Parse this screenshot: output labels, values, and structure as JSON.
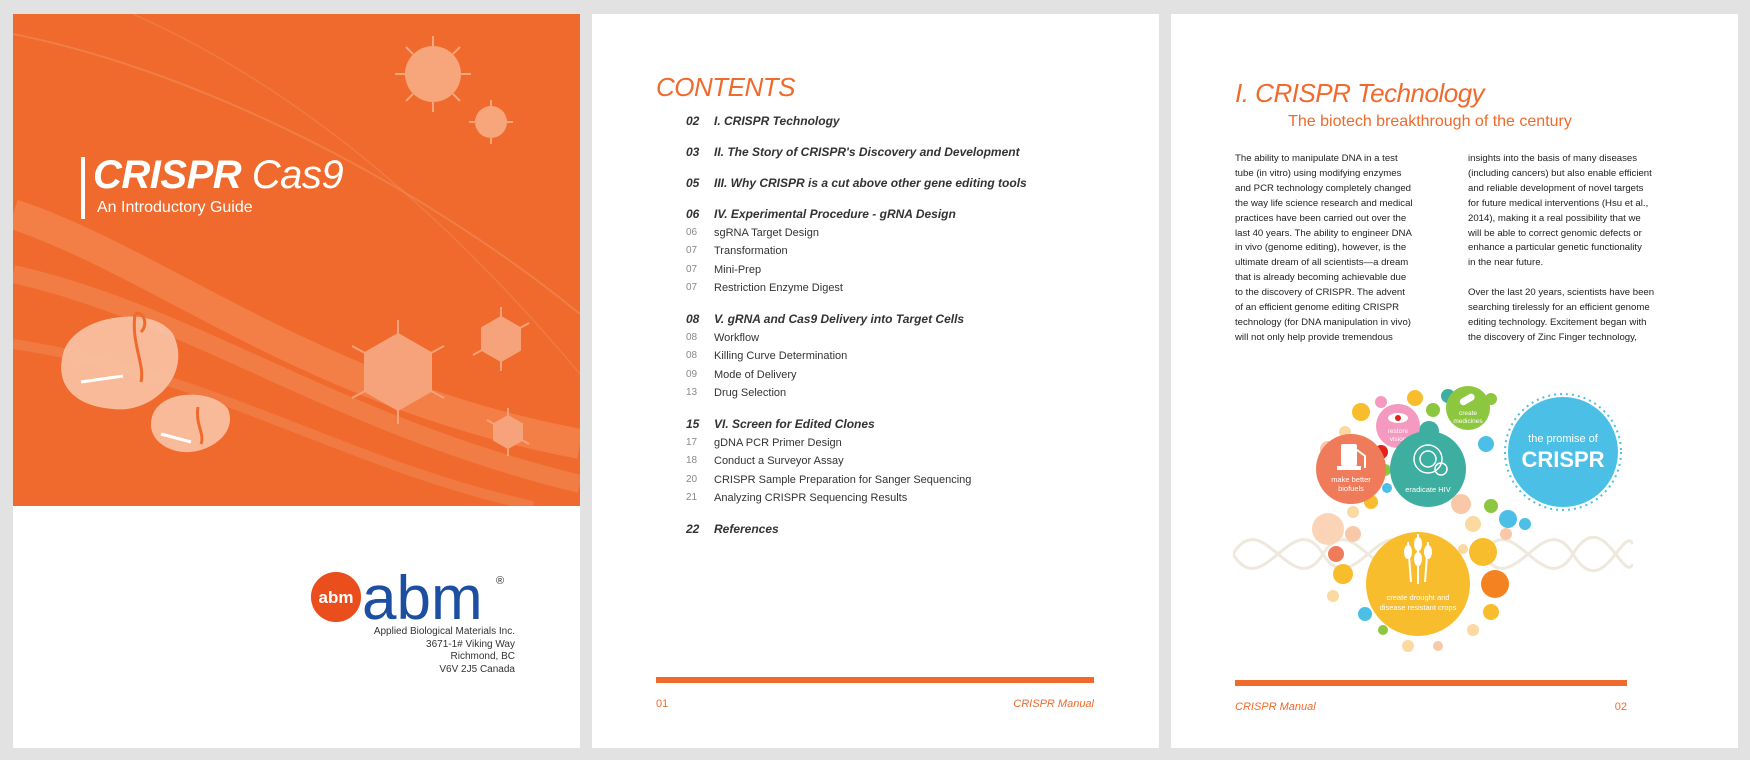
{
  "cover": {
    "title_bold": "CRISPR",
    "title_light": " Cas9",
    "subtitle": "An Introductory Guide",
    "logo_badge": "abm",
    "logo_text": "abm",
    "registered": "®",
    "address": [
      "Applied Biological Materials Inc.",
      "3671-1# Viking Way",
      "Richmond, BC",
      "V6V 2J5 Canada"
    ]
  },
  "contents": {
    "title": "CONTENTS",
    "entries": [
      {
        "page": "02",
        "label": "I. CRISPR Technology",
        "level": "main"
      },
      {
        "page": "03",
        "label": "II. The Story of CRISPR's Discovery and Development",
        "level": "main"
      },
      {
        "page": "05",
        "label": "III. Why CRISPR is a cut above other gene editing tools",
        "level": "main"
      },
      {
        "page": "06",
        "label": "IV. Experimental Procedure - gRNA Design",
        "level": "main"
      },
      {
        "page": "06",
        "label": "sgRNA Target Design",
        "level": "sub"
      },
      {
        "page": "07",
        "label": "Transformation",
        "level": "sub"
      },
      {
        "page": "07",
        "label": "Mini-Prep",
        "level": "sub"
      },
      {
        "page": "07",
        "label": "Restriction Enzyme Digest",
        "level": "sub"
      },
      {
        "page": "08",
        "label": "V. gRNA and Cas9 Delivery into Target Cells",
        "level": "main"
      },
      {
        "page": "08",
        "label": "Workflow",
        "level": "sub"
      },
      {
        "page": "08",
        "label": "Killing Curve Determination",
        "level": "sub"
      },
      {
        "page": "09",
        "label": "Mode of Delivery",
        "level": "sub"
      },
      {
        "page": "13",
        "label": "Drug Selection",
        "level": "sub"
      },
      {
        "page": "15",
        "label": "VI. Screen for Edited Clones",
        "level": "main"
      },
      {
        "page": "17",
        "label": "gDNA PCR Primer Design",
        "level": "sub"
      },
      {
        "page": "18",
        "label": "Conduct a Surveyor Assay",
        "level": "sub"
      },
      {
        "page": "20",
        "label": "CRISPR Sample Preparation for Sanger Sequencing",
        "level": "sub"
      },
      {
        "page": "21",
        "label": "Analyzing CRISPR Sequencing Results",
        "level": "sub"
      },
      {
        "page": "22",
        "label": "References",
        "level": "main"
      }
    ],
    "footer_page": "01",
    "footer_title": "CRISPR Manual"
  },
  "chapter": {
    "title": "I. CRISPR Technology",
    "subtitle": "The biotech breakthrough of the century",
    "col1": [
      "The ability to manipulate DNA in a test",
      "tube (in vitro) using modifying enzymes",
      "and PCR technology completely changed",
      "the way life science research and medical",
      "practices have been carried out over the",
      "last 40 years. The ability to engineer DNA",
      "in vivo (genome editing), however, is the",
      "ultimate dream of all scientists—a dream",
      "that is already becoming achievable due",
      "to the discovery of CRISPR. The advent",
      "of an efficient genome editing CRISPR",
      "technology (for DNA manipulation in vivo)",
      "will not only help provide tremendous"
    ],
    "col2": [
      "insights into the basis of many diseases",
      "(including cancers) but also enable efficient",
      "and reliable development of novel targets",
      "for future medical interventions (Hsu et al.,",
      "2014), making it a real possibility that we",
      "will be able to correct genomic defects or",
      "enhance a particular genetic functionality",
      "in the near future.",
      "",
      "Over the last 20 years, scientists have been",
      "searching tirelessly for an efficient genome",
      "editing technology. Excitement began with",
      "the discovery of Zinc Finger technology,"
    ],
    "infographic": {
      "promise_line1": "the promise of",
      "promise_line2": "CRISPR",
      "medicines_line1": "create",
      "medicines_line2": "medicines",
      "vision_line1": "restore",
      "vision_line2": "vision",
      "biofuels_line1": "make better",
      "biofuels_line2": "biofuels",
      "hiv": "eradicate HIV",
      "crops_line1": "create drought and",
      "crops_line2": "disease resistant crops",
      "colors": {
        "blue": "#4bbfe6",
        "orange": "#ef7b5a",
        "teal": "#3dae9f",
        "yellow": "#f7bd2c",
        "green": "#8dc63f",
        "pink": "#f49ac1"
      }
    },
    "footer_title": "CRISPR Manual",
    "footer_page": "02"
  },
  "colors": {
    "accent": "#ef6a2c",
    "abm_red": "#e2231a",
    "abm_blue": "#1c4fa1",
    "abm_green": "#1a9d49"
  }
}
